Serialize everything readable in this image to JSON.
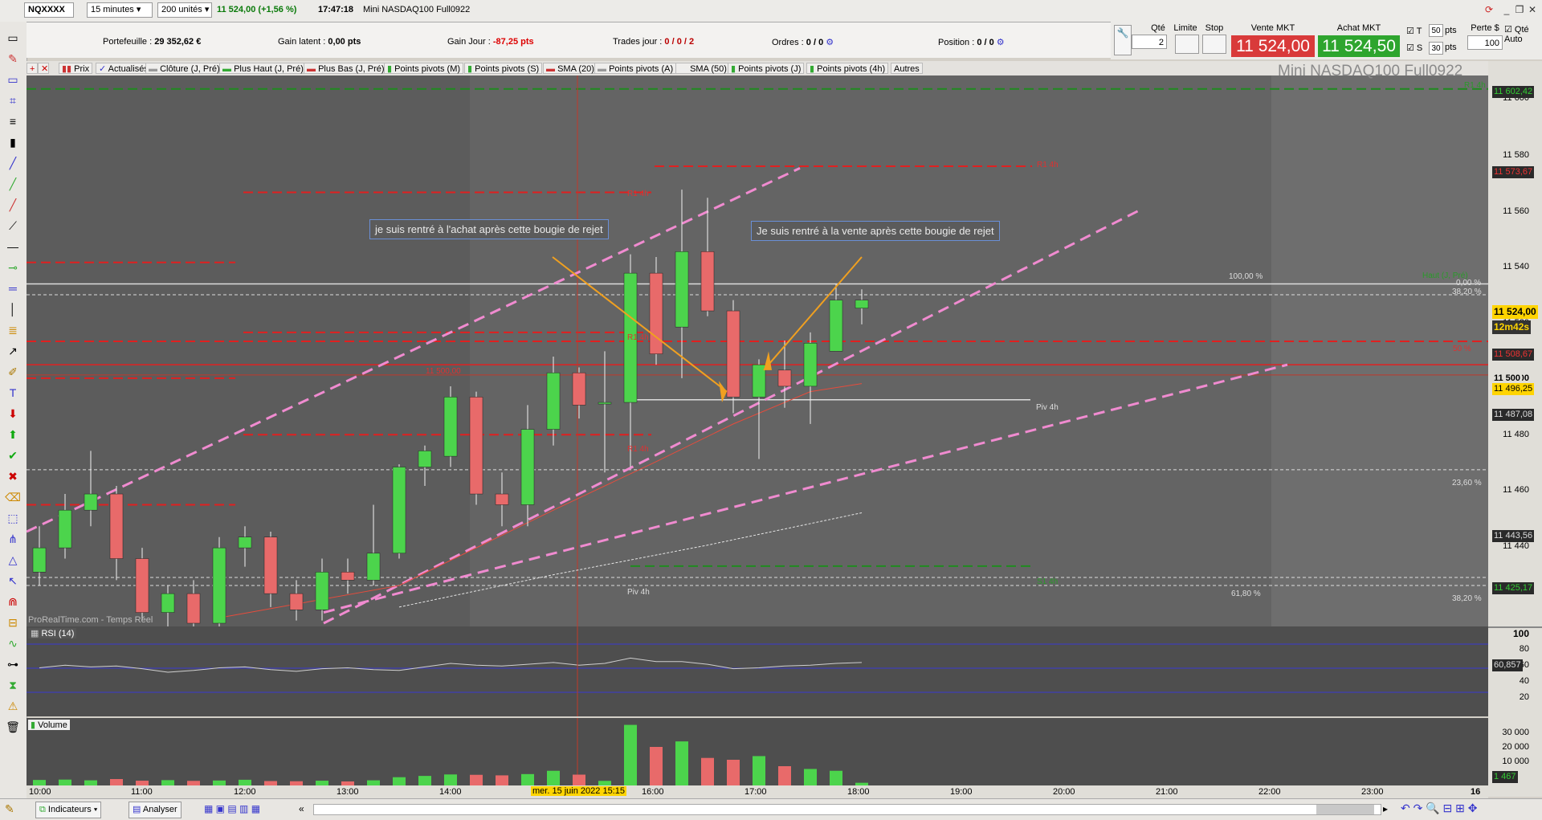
{
  "topbar": {
    "symbol": "NQXXXX",
    "interval": "15 minutes",
    "units": "200 unités",
    "price": "11 524,00",
    "change": "(+1,56 %)",
    "time": "17:47:18",
    "instrument": "Mini NASDAQ100 Full0922"
  },
  "info": {
    "portefeuille_label": "Portefeuille :",
    "portefeuille_value": "29 352,62 €",
    "gain_latent_label": "Gain latent :",
    "gain_latent_value": "0,00 pts",
    "gain_jour_label": "Gain Jour :",
    "gain_jour_value": "-87,25 pts",
    "trades_label": "Trades jour :",
    "trades_value": "0 / 0 / 2",
    "ordres_label": "Ordres :",
    "ordres_value": "0 / 0",
    "position_label": "Position :",
    "position_value": "0 / 0"
  },
  "order_panel": {
    "qte_label": "Qté",
    "qte_value": "2",
    "limite_label": "Limite",
    "stop_label": "Stop",
    "vente_label": "Vente MKT",
    "vente_price": "11 524,00",
    "achat_label": "Achat MKT",
    "achat_price": "11 524,50",
    "t_label": "T",
    "t_value": "50",
    "s_label": "S",
    "s_value": "30",
    "pts": "pts",
    "perte_label": "Perte $",
    "qte_auto_label": "Qté Auto",
    "qte_auto_value": "100"
  },
  "indicators": [
    "Prix",
    "Actualisés",
    "Clôture (J, Pré)",
    "Plus Haut (J, Pré)",
    "Plus Bas (J, Pré)",
    "Points pivots (M)",
    "Points pivots (S)",
    "SMA (20)",
    "Points pivots (A)",
    "SMA (50)",
    "Points pivots (J)",
    "Points pivots (4h)",
    "Autres"
  ],
  "chart_watermark": "Mini NASDAQ100 Full0922",
  "chart_footer": "ProRealTime.com - Temps Réel",
  "annotations": {
    "buy": "je suis rentré à l'achat après cette bougie de rejet",
    "sell": "Je suis rentré à la vente après cette bougie de rejet"
  },
  "chart_labels": {
    "r1_4h": "R1 4h",
    "piv_4h": "Piv 4h",
    "s1_4h": "S1 4h",
    "level_11500": "11 500,00",
    "fib_100": "100,00 %",
    "fib_0": "0,00 %",
    "fib_382": "38,20 %",
    "fib_50": "50 %",
    "fib_236": "23,60 %",
    "fib_618": "61,80 %",
    "haut_label": "Haut (J, Pré)",
    "r1_label": "R1 4h"
  },
  "price_axis": [
    "11 600",
    "11 580",
    "11 560",
    "11 540",
    "11 520",
    "11 500",
    "11 480",
    "11 460",
    "11 440"
  ],
  "price_tags": {
    "top": "11 602,42",
    "r1": "11 573,67",
    "current": "11 524,00",
    "countdown": "12m42s",
    "level1": "11 508,67",
    "level2": "11 500",
    "level3": "11 496,25",
    "level4": "11 487,08",
    "level5": "11 443,56",
    "level6": "11 425,17"
  },
  "rsi": {
    "label": "RSI (14)",
    "value": "60,857",
    "axis": [
      "100",
      "80",
      "60",
      "40",
      "20"
    ]
  },
  "volume": {
    "label": "Volume",
    "value": "1 467",
    "axis": [
      "30 000",
      "20 000",
      "10 000"
    ]
  },
  "time_axis": [
    "10:00",
    "11:00",
    "12:00",
    "13:00",
    "14:00",
    "16:00",
    "17:00",
    "18:00",
    "19:00",
    "20:00",
    "21:00",
    "22:00",
    "23:00",
    "16"
  ],
  "cursor_date": "mer. 15 juin 2022 15:15",
  "bottom": {
    "indicateurs": "Indicateurs",
    "analyser": "Analyser"
  },
  "chart_data": {
    "type": "candlestick",
    "candles": [
      {
        "t": "10:00",
        "o": 11423,
        "h": 11440,
        "l": 11418,
        "c": 11432
      },
      {
        "t": "10:15",
        "o": 11432,
        "h": 11452,
        "l": 11428,
        "c": 11446
      },
      {
        "t": "10:30",
        "o": 11446,
        "h": 11468,
        "l": 11440,
        "c": 11452
      },
      {
        "t": "10:45",
        "o": 11452,
        "h": 11455,
        "l": 11420,
        "c": 11428
      },
      {
        "t": "11:00",
        "o": 11428,
        "h": 11432,
        "l": 11405,
        "c": 11408
      },
      {
        "t": "11:15",
        "o": 11408,
        "h": 11418,
        "l": 11398,
        "c": 11415
      },
      {
        "t": "11:30",
        "o": 11415,
        "h": 11420,
        "l": 11400,
        "c": 11404
      },
      {
        "t": "11:45",
        "o": 11404,
        "h": 11436,
        "l": 11400,
        "c": 11432
      },
      {
        "t": "12:00",
        "o": 11432,
        "h": 11440,
        "l": 11425,
        "c": 11436
      },
      {
        "t": "12:15",
        "o": 11436,
        "h": 11438,
        "l": 11410,
        "c": 11415
      },
      {
        "t": "12:30",
        "o": 11415,
        "h": 11420,
        "l": 11405,
        "c": 11409
      },
      {
        "t": "12:45",
        "o": 11409,
        "h": 11428,
        "l": 11405,
        "c": 11423
      },
      {
        "t": "13:00",
        "o": 11423,
        "h": 11428,
        "l": 11415,
        "c": 11420
      },
      {
        "t": "13:15",
        "o": 11420,
        "h": 11448,
        "l": 11418,
        "c": 11430
      },
      {
        "t": "13:30",
        "o": 11430,
        "h": 11463,
        "l": 11428,
        "c": 11462
      },
      {
        "t": "13:45",
        "o": 11462,
        "h": 11470,
        "l": 11455,
        "c": 11468
      },
      {
        "t": "14:00",
        "o": 11466,
        "h": 11492,
        "l": 11462,
        "c": 11488
      },
      {
        "t": "14:15",
        "o": 11488,
        "h": 11490,
        "l": 11448,
        "c": 11452
      },
      {
        "t": "14:30",
        "o": 11452,
        "h": 11460,
        "l": 11440,
        "c": 11448
      },
      {
        "t": "14:45",
        "o": 11448,
        "h": 11485,
        "l": 11440,
        "c": 11476
      },
      {
        "t": "15:00",
        "o": 11476,
        "h": 11503,
        "l": 11470,
        "c": 11497
      },
      {
        "t": "15:15",
        "o": 11497,
        "h": 11499,
        "l": 11480,
        "c": 11485
      },
      {
        "t": "15:30",
        "o": 11486,
        "h": 11505,
        "l": 11460,
        "c": 11486
      },
      {
        "t": "15:45",
        "o": 11486,
        "h": 11541,
        "l": 11462,
        "c": 11534
      },
      {
        "t": "16:00",
        "o": 11534,
        "h": 11540,
        "l": 11500,
        "c": 11504
      },
      {
        "t": "16:15",
        "o": 11514,
        "h": 11565,
        "l": 11495,
        "c": 11542
      },
      {
        "t": "16:30",
        "o": 11542,
        "h": 11562,
        "l": 11518,
        "c": 11520
      },
      {
        "t": "16:45",
        "o": 11520,
        "h": 11524,
        "l": 11482,
        "c": 11488
      },
      {
        "t": "17:00",
        "o": 11488,
        "h": 11502,
        "l": 11465,
        "c": 11500
      },
      {
        "t": "17:15",
        "o": 11498,
        "h": 11509,
        "l": 11484,
        "c": 11492
      },
      {
        "t": "17:30",
        "o": 11492,
        "h": 11512,
        "l": 11478,
        "c": 11508
      },
      {
        "t": "17:45",
        "o": 11505,
        "h": 11530,
        "l": 11505,
        "c": 11524
      },
      {
        "t": "18:00",
        "o": 11521,
        "h": 11528,
        "l": 11515,
        "c": 11524
      }
    ],
    "volume": [
      3000,
      3200,
      2800,
      3500,
      2600,
      2900,
      2500,
      2700,
      3100,
      2400,
      2300,
      2600,
      2200,
      2800,
      4500,
      5200,
      6000,
      5800,
      5500,
      6200,
      8000,
      5900,
      2500,
      33000,
      21000,
      24000,
      15000,
      14000,
      16000,
      10500,
      9000,
      8000,
      1467
    ],
    "ylim": [
      11400,
      11620
    ]
  }
}
